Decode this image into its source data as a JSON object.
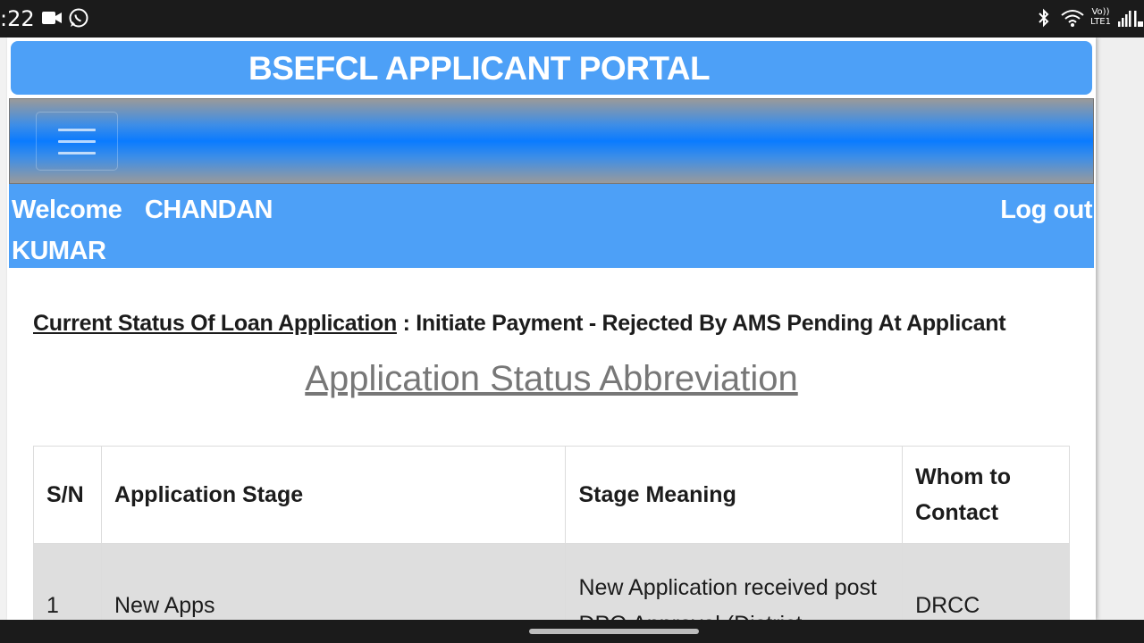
{
  "status_bar": {
    "time": ":22",
    "lte_top": "Vo))",
    "lte_bottom": "LTE1",
    "icons": [
      "video-camera-icon",
      "whatsapp-icon",
      "bluetooth-icon",
      "wifi-icon",
      "lte-badge",
      "signal-icon",
      "signal-icon"
    ]
  },
  "portal": {
    "title": "BSEFCL APPLICANT PORTAL"
  },
  "navbar": {
    "menu_icon": "hamburger-menu-icon"
  },
  "welcome": {
    "greeting": "Welcome",
    "user_first": "CHANDAN",
    "user_last": "KUMAR",
    "logout_label": "Log out"
  },
  "status": {
    "label": "Current Status Of Loan Application",
    "separator": " : ",
    "value": "Initiate Payment - Rejected By AMS Pending At Applicant"
  },
  "abbreviation": {
    "heading": "Application Status Abbreviation"
  },
  "table": {
    "headers": [
      "S/N",
      "Application Stage",
      "Stage Meaning",
      "Whom to Contact"
    ],
    "rows": [
      {
        "sn": "1",
        "stage": "New Apps",
        "meaning": "New Application received post DPO Approval (District",
        "contact": "DRCC"
      }
    ]
  },
  "colors": {
    "header_blue": "#4da0f7",
    "navbar_blue": "#0a7bff",
    "row_gray": "#dedede"
  }
}
